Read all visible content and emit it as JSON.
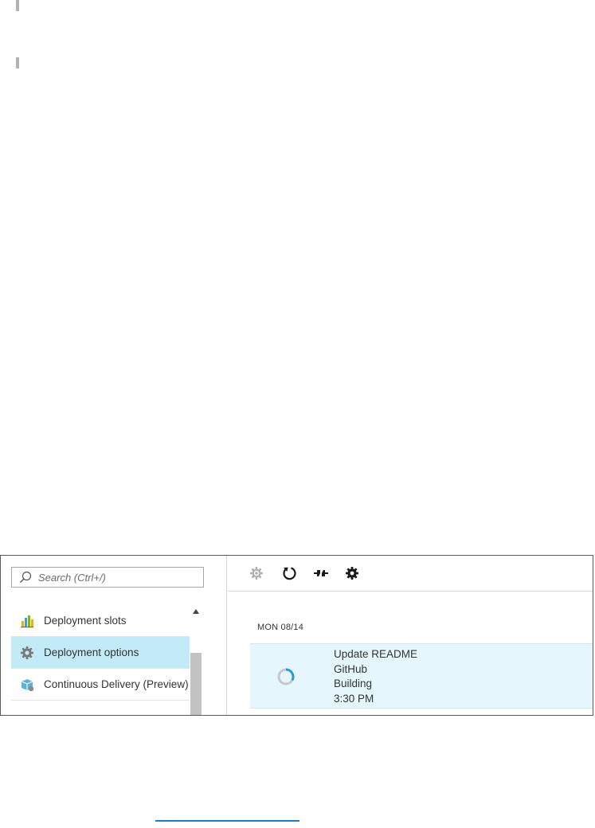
{
  "search": {
    "placeholder": "Search (Ctrl+/)",
    "value": ""
  },
  "sidebar": {
    "items": [
      {
        "label": "Deployment slots",
        "icon": "deployment-slots-icon",
        "selected": false
      },
      {
        "label": "Deployment options",
        "icon": "gear-icon",
        "selected": true
      },
      {
        "label": "Continuous Delivery (Preview)",
        "icon": "continuous-delivery-icon",
        "selected": false
      }
    ]
  },
  "toolbar": {
    "buttons": [
      {
        "icon": "setup-icon",
        "enabled": false
      },
      {
        "icon": "refresh-icon",
        "enabled": true
      },
      {
        "icon": "disconnect-icon",
        "enabled": true
      },
      {
        "icon": "settings-icon",
        "enabled": true
      }
    ]
  },
  "deployments": {
    "date_heading": "MON 08/14",
    "items": [
      {
        "message": "Update README",
        "source": "GitHub",
        "status": "Building",
        "time": "3:30 PM"
      }
    ]
  },
  "colors": {
    "selected_item_bg": "#c2ebf7",
    "row_bg": "#e5f6fc",
    "accent": "#1f7ac7",
    "spinner": "#2d9ad6"
  }
}
